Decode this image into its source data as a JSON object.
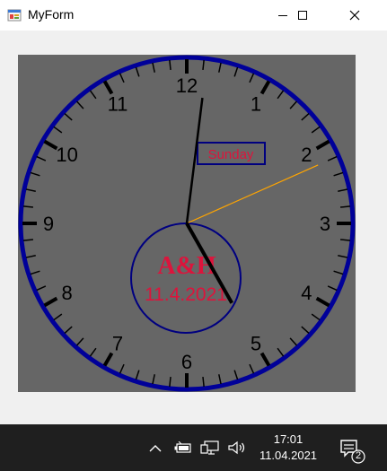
{
  "window": {
    "title": "MyForm",
    "controls": {
      "minimize": "minimize",
      "maximize": "maximize",
      "close": "close"
    }
  },
  "clock": {
    "numerals": [
      "12",
      "1",
      "2",
      "3",
      "4",
      "5",
      "6",
      "7",
      "8",
      "9",
      "10",
      "11"
    ],
    "day_label": "Sunday",
    "brand": "A&H",
    "date": "11.4.2021",
    "time": {
      "hour": 17,
      "minute": 1,
      "second": 11
    },
    "colors": {
      "face": "#666666",
      "rim": "#000099",
      "text_red": "#dc143c",
      "hands": "#000000",
      "second_hand": "#ffa500",
      "day_box": "#000080"
    }
  },
  "taskbar": {
    "time": "17:01",
    "date": "11.04.2021",
    "notification_count": "2",
    "icons": [
      "chevron-up-icon",
      "battery-icon",
      "network-icon",
      "volume-icon",
      "notification-icon"
    ]
  }
}
